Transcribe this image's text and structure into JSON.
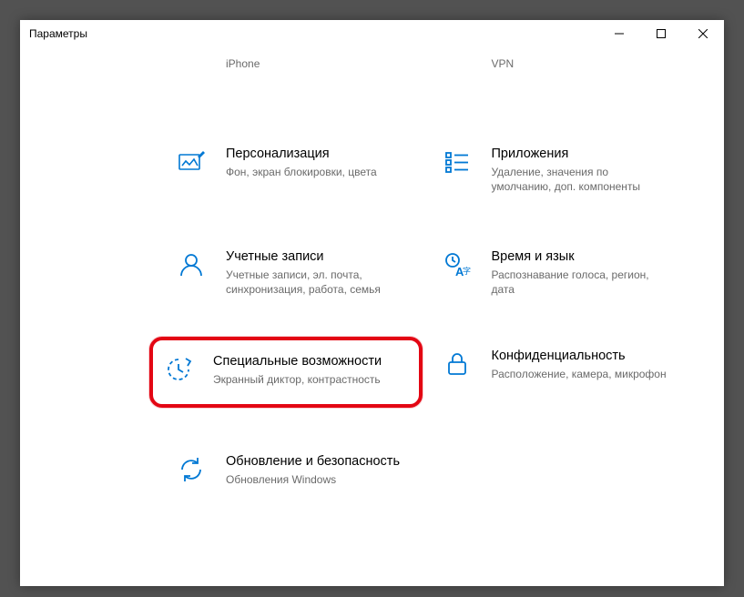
{
  "window": {
    "title": "Параметры"
  },
  "cards": {
    "phone": {
      "title": "",
      "desc": "iPhone"
    },
    "network": {
      "title": "",
      "desc": "VPN"
    },
    "personalize": {
      "title": "Персонализация",
      "desc": "Фон, экран блокировки, цвета"
    },
    "apps": {
      "title": "Приложения",
      "desc": "Удаление, значения по умолчанию, доп. компоненты"
    },
    "accounts": {
      "title": "Учетные записи",
      "desc": "Учетные записи, эл. почта, синхронизация, работа, семья"
    },
    "time": {
      "title": "Время и язык",
      "desc": "Распознавание голоса, регион, дата"
    },
    "access": {
      "title": "Специальные возможности",
      "desc": "Экранный диктор, контрастность"
    },
    "privacy": {
      "title": "Конфиденциальность",
      "desc": "Расположение, камера, микрофон"
    },
    "update": {
      "title": "Обновление и безопасность",
      "desc": "Обновления Windows"
    }
  }
}
